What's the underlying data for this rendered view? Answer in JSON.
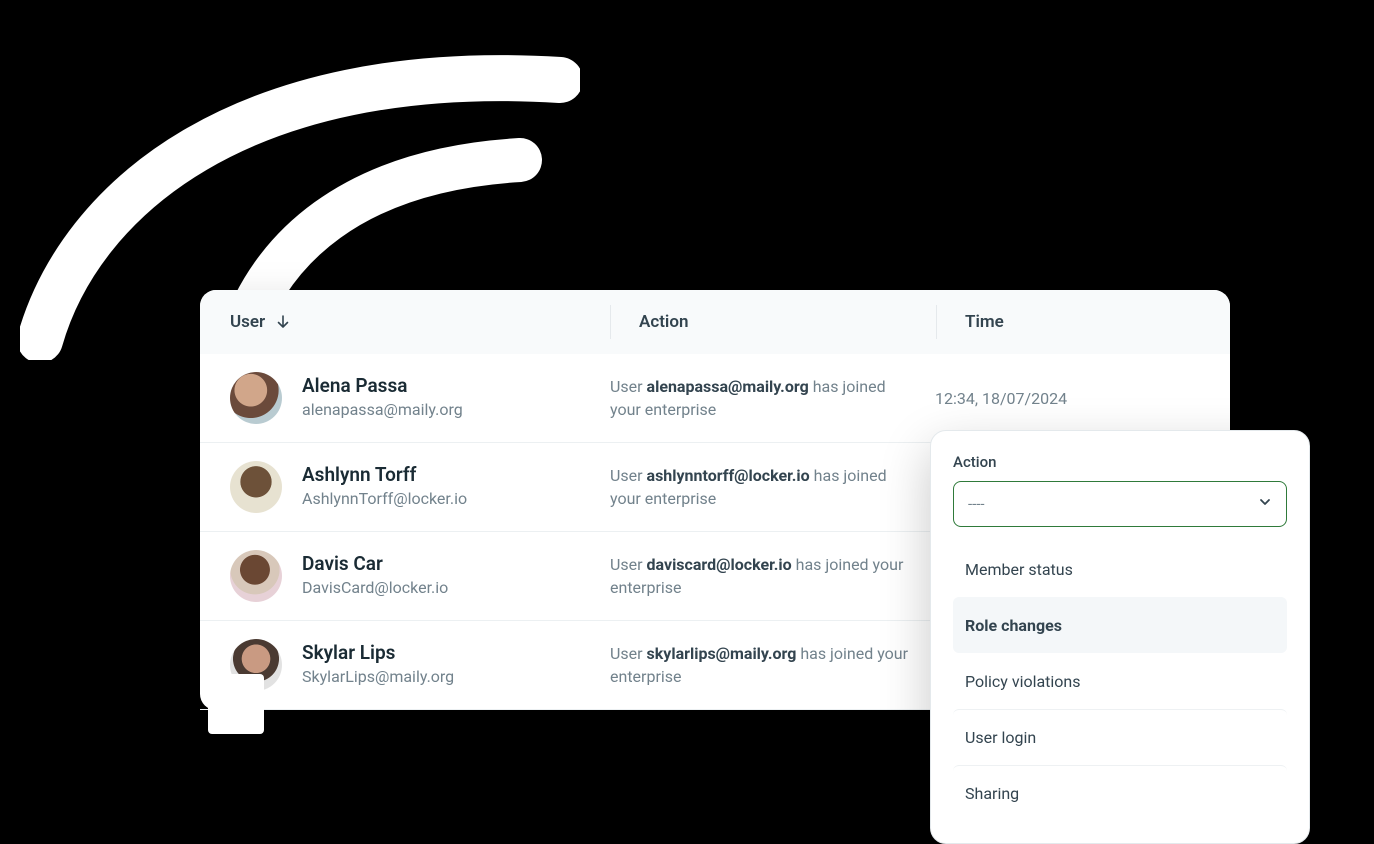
{
  "table": {
    "headers": {
      "user": "User",
      "action": "Action",
      "time": "Time"
    },
    "action_template": {
      "prefix": "User ",
      "suffix": " has joined your enterprise"
    },
    "rows": [
      {
        "name": "Alena Passa",
        "email": "alenapassa@maily.org",
        "action_email": "alenapassa@maily.org",
        "time": "12:34, 18/07/2024"
      },
      {
        "name": "Ashlynn Torff",
        "email": "AshlynnTorff@locker.io",
        "action_email": "ashlynntorff@locker.io",
        "time": ""
      },
      {
        "name": "Davis Car",
        "email": "DavisCard@locker.io",
        "action_email": "daviscard@locker.io",
        "time": ""
      },
      {
        "name": "Skylar Lips",
        "email": "SkylarLips@maily.org",
        "action_email": "skylarlips@maily.org",
        "time": ""
      }
    ]
  },
  "dropdown": {
    "label": "Action",
    "selected": "----",
    "options": [
      {
        "label": "Member status",
        "highlight": false
      },
      {
        "label": "Role changes",
        "highlight": true
      },
      {
        "label": "Policy violations",
        "highlight": false
      },
      {
        "label": "User login",
        "highlight": false
      },
      {
        "label": "Sharing",
        "highlight": false
      }
    ]
  }
}
